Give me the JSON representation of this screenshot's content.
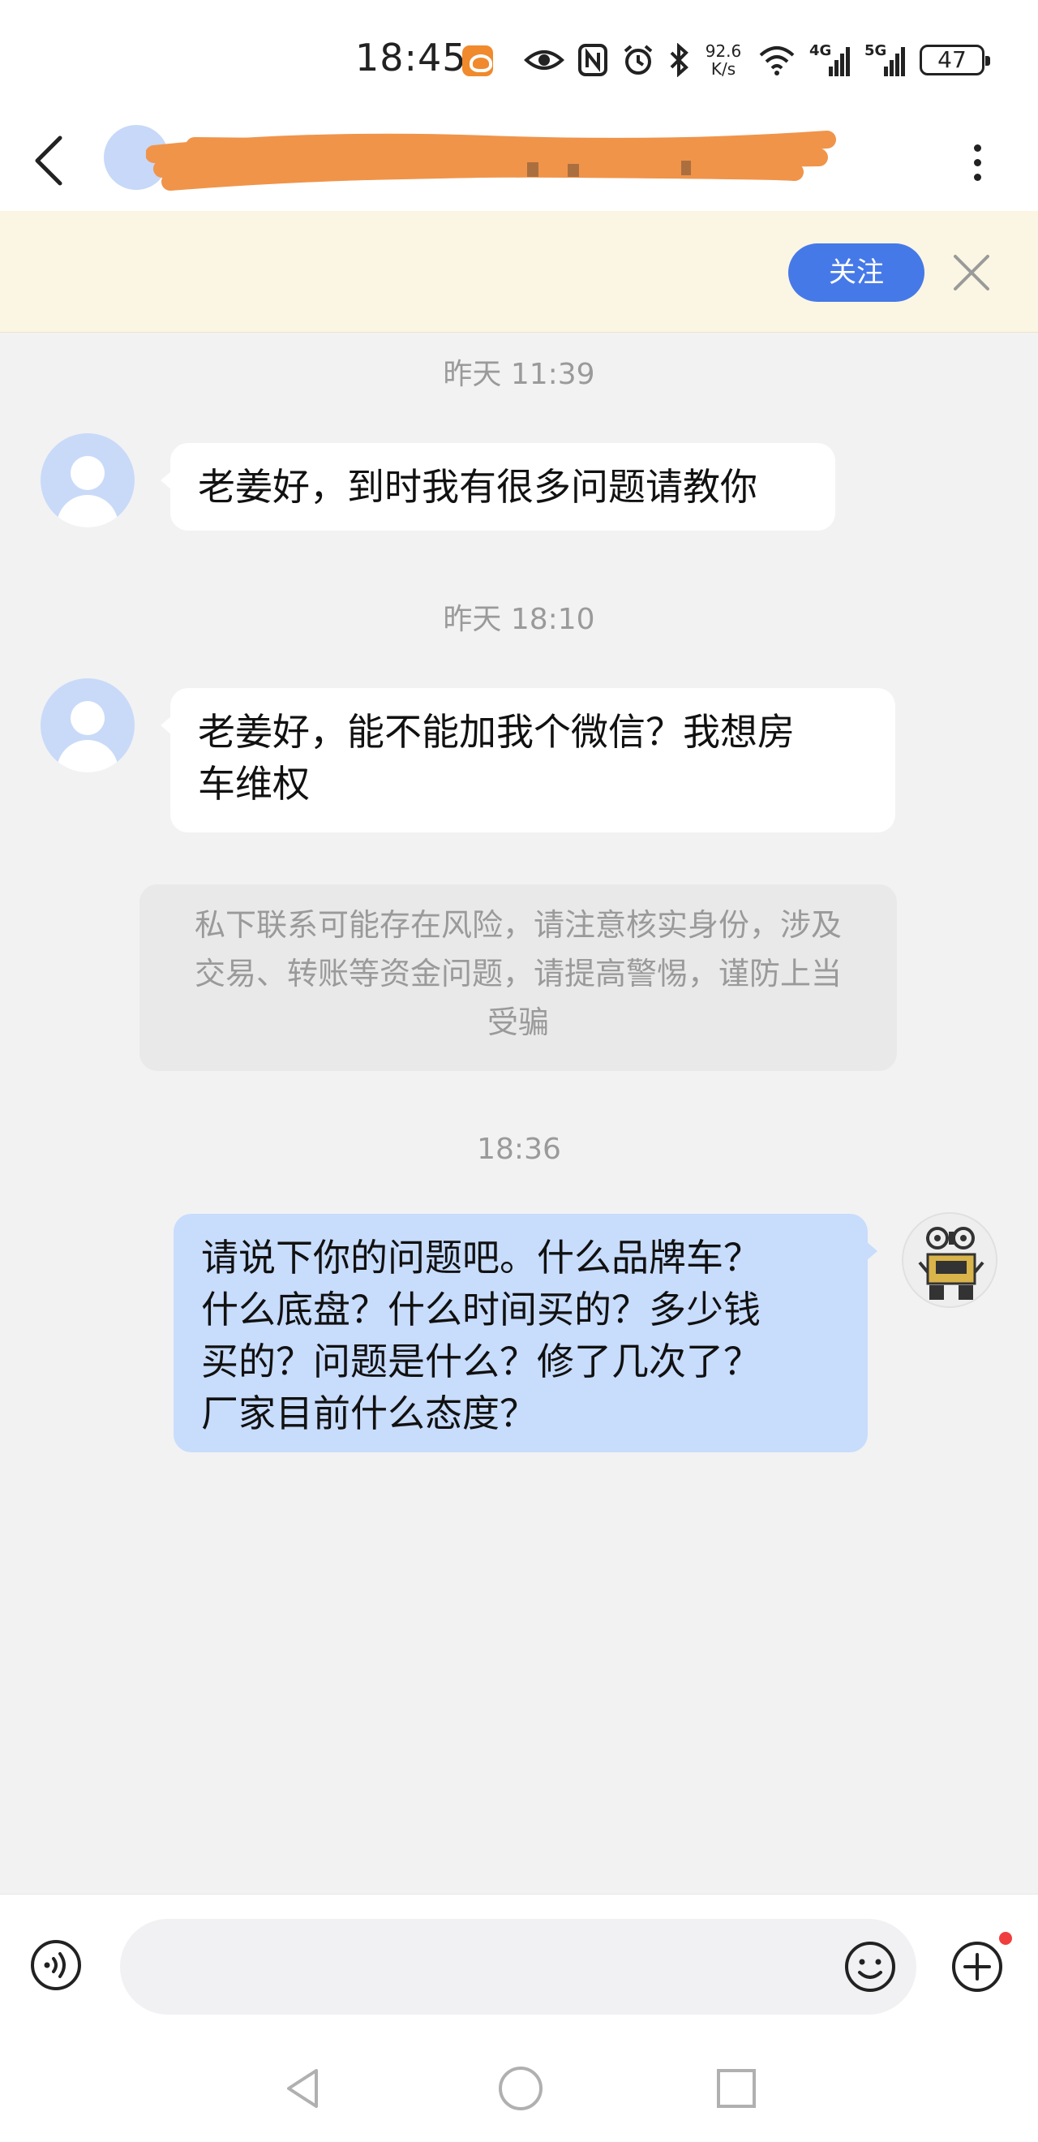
{
  "status_bar": {
    "time": "18:45",
    "net_speed_value": "92.6",
    "net_speed_unit": "K/s",
    "signal1_label": "4G",
    "signal2_label": "5G",
    "battery": "47",
    "icons": [
      "app-badge-icon",
      "eye-icon",
      "nfc-icon",
      "alarm-icon",
      "bluetooth-icon",
      "wifi-icon",
      "signal-4g-icon",
      "signal-5g-icon",
      "battery-icon"
    ]
  },
  "header": {
    "title": "",
    "title_redacted": true,
    "redaction_color": "#f0944a"
  },
  "banner": {
    "follow_label": "关注",
    "accent_color": "#4679e8"
  },
  "messages": [
    {
      "timestamp": "昨天 11:39",
      "side": "left",
      "text": "老姜好，到时我有很多问题请教你"
    },
    {
      "timestamp": "昨天 18:10",
      "side": "left",
      "text_line1": "老姜好，能不能加我个微信？我想房",
      "text_line2": "车维权"
    }
  ],
  "system_notice": {
    "line1": "私下联系可能存在风险，请注意核实身份，涉及",
    "line2": "交易、转账等资金问题，请提高警惕，谨防上当",
    "line3": "受骗"
  },
  "reply": {
    "timestamp": "18:36",
    "side": "right",
    "line1": "请说下你的问题吧。什么品牌车？",
    "line2": "什么底盘？什么时间买的？多少钱",
    "line3": "买的？问题是什么？修了几次了？",
    "line4": "厂家目前什么态度？",
    "bubble_color": "#c8dcfc"
  },
  "input_bar": {
    "placeholder": "",
    "has_notification_dot": true
  }
}
